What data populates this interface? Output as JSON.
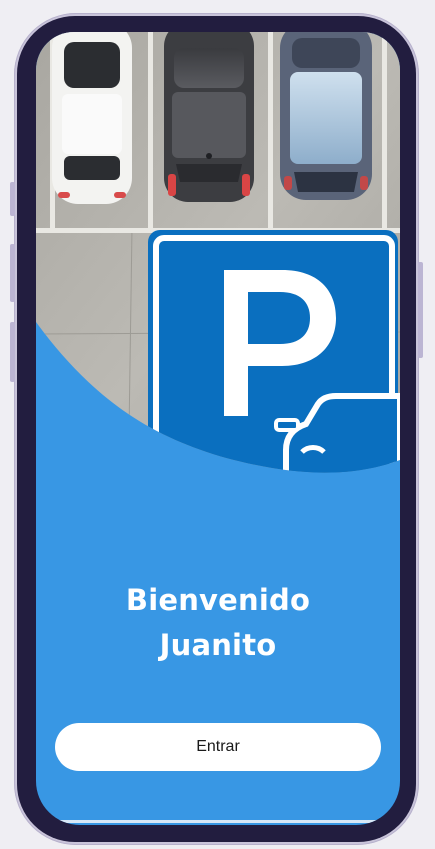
{
  "welcome": {
    "line1": "Bienvenido",
    "line2": "Juanito"
  },
  "actions": {
    "enter_label": "Entrar"
  },
  "colors": {
    "primary": "#3897e4",
    "sign_blue": "#0a6fbf",
    "phone_bezel": "#221d3f",
    "background": "#efeef3"
  },
  "icons": {
    "parking_sign": "parking-sign-icon",
    "car": "car-icon"
  }
}
